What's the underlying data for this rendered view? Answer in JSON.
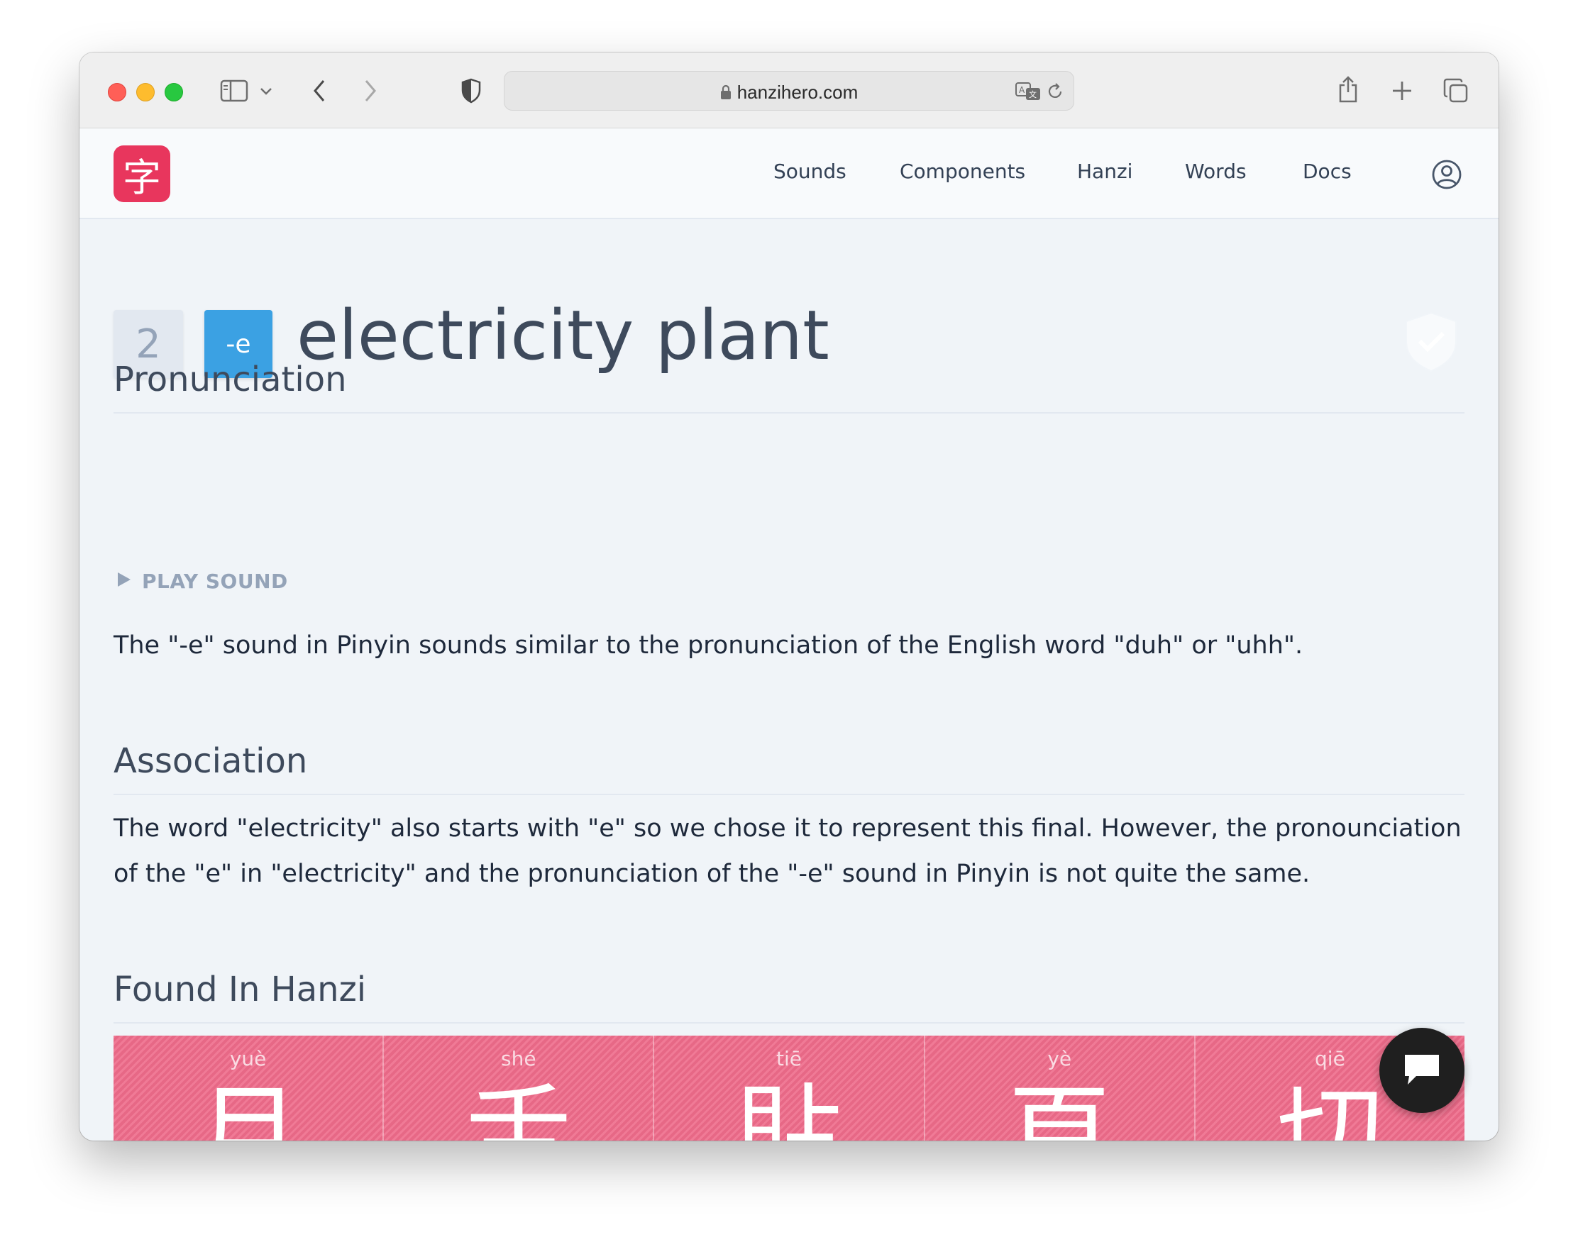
{
  "browser": {
    "url": "hanzihero.com",
    "icons": [
      "sidebar-icon",
      "chevron-down-icon",
      "back-icon",
      "forward-icon",
      "shield-icon",
      "lock-icon",
      "translate-icon",
      "reload-icon",
      "share-icon",
      "new-tab-icon",
      "tabs-overview-icon"
    ]
  },
  "header": {
    "logo_char": "字",
    "nav": [
      "Sounds",
      "Components",
      "Hanzi",
      "Words",
      "Docs"
    ],
    "account_icon": "user-circle-icon"
  },
  "page": {
    "number": "2",
    "final": "-e",
    "title": "electricity plant",
    "status_icon": "check-shield-icon"
  },
  "pronunciation": {
    "heading": "Pronunciation",
    "play_label": "PLAY SOUND",
    "text": "The \"-e\" sound in Pinyin sounds similar to the pronunciation of the English word \"duh\" or \"uhh\"."
  },
  "association": {
    "heading": "Association",
    "text": "The word \"electricity\" also starts with \"e\" so we chose it to represent this final. However, the pronounciation of the \"e\" in \"electricity\" and the pronunciation of the \"-e\" sound in Pinyin is not quite the same."
  },
  "found_in": {
    "heading": "Found In Hanzi",
    "hanzi": [
      {
        "pinyin": "yuè",
        "char": "月"
      },
      {
        "pinyin": "shé",
        "char": "舌"
      },
      {
        "pinyin": "tiē",
        "char": "貼"
      },
      {
        "pinyin": "yè",
        "char": "頁"
      },
      {
        "pinyin": "qiē",
        "char": "切"
      }
    ]
  },
  "colors": {
    "brand": "#e8365d",
    "final_badge": "#3ba1e3",
    "hanzi_card": "#ee6b8a",
    "text_heading": "#3e4a5c"
  },
  "chat_icon": "chat-bubble-icon"
}
